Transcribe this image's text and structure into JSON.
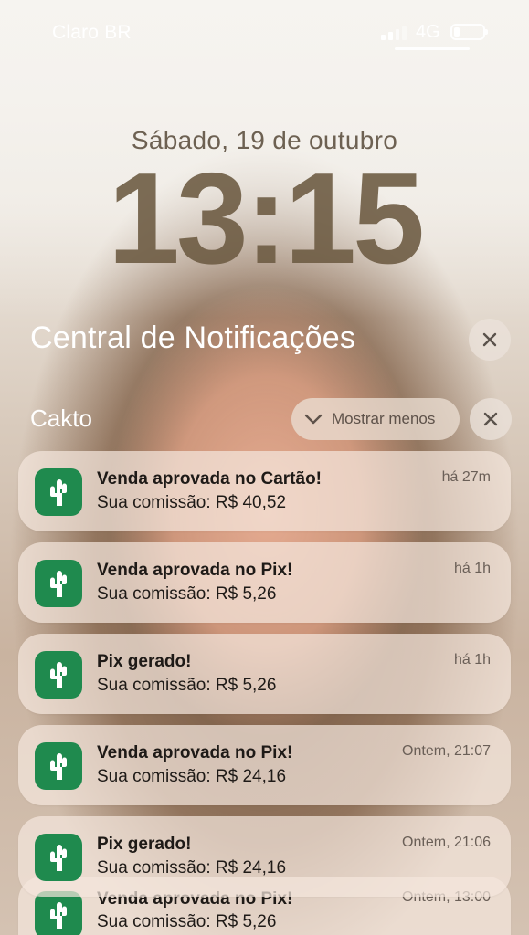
{
  "status_bar": {
    "carrier": "Claro BR",
    "network": "4G",
    "battery_level": 0.2,
    "icons": [
      "signal-icon",
      "battery-icon"
    ]
  },
  "lock_screen": {
    "date": "Sábado, 19 de outubro",
    "time": "13:15"
  },
  "notification_center": {
    "title": "Central de Notificações",
    "close_icon": "close-icon"
  },
  "group": {
    "app_name": "Cakto",
    "show_less_label": "Mostrar menos",
    "chevron_icon": "chevron-down-icon",
    "close_icon": "close-icon"
  },
  "notifications": [
    {
      "title": "Venda aprovada no Cartão!",
      "body": "Sua comissão: R$ 40,52",
      "time": "há 27m",
      "icon": "cactus-icon"
    },
    {
      "title": "Venda aprovada no Pix!",
      "body": "Sua comissão: R$ 5,26",
      "time": "há 1h",
      "icon": "cactus-icon"
    },
    {
      "title": "Pix gerado!",
      "body": "Sua comissão: R$ 5,26",
      "time": "há 1h",
      "icon": "cactus-icon"
    },
    {
      "title": "Venda aprovada no Pix!",
      "body": "Sua comissão: R$ 24,16",
      "time": "Ontem, 21:07",
      "icon": "cactus-icon"
    },
    {
      "title": "Pix gerado!",
      "body": "Sua comissão: R$ 24,16",
      "time": "Ontem, 21:06",
      "icon": "cactus-icon"
    },
    {
      "title": "Venda aprovada no Pix!",
      "body": "Sua comissão: R$ 5,26",
      "time": "Ontem, 13:00",
      "icon": "cactus-icon"
    }
  ],
  "colors": {
    "app_icon_bg": "#1f8a4e",
    "card_bg": "rgba(244,230,220,0.72)"
  }
}
